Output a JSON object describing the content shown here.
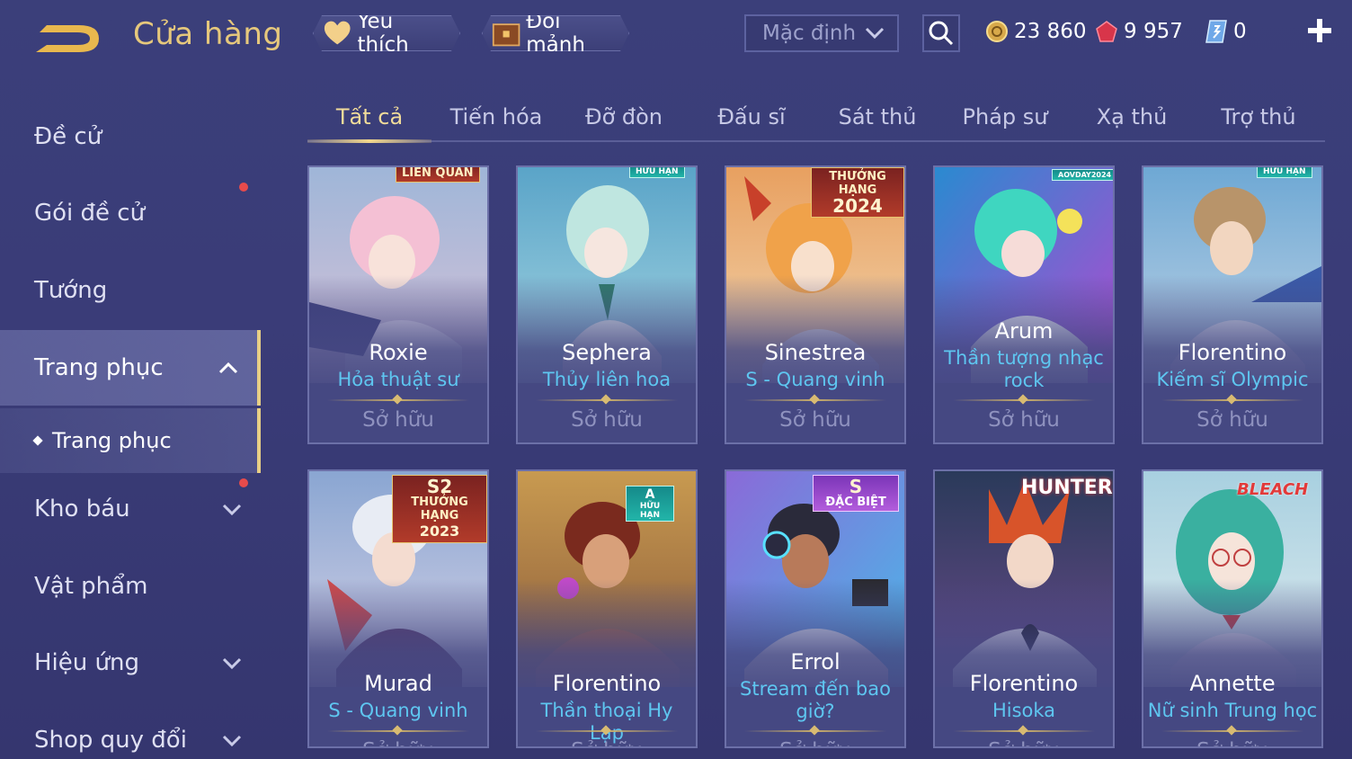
{
  "header": {
    "title": "Cửa hàng",
    "favorite_label": "Yêu thích",
    "shard_label": "Đổi mảnh",
    "sort_value": "Mặc định",
    "currency": {
      "gold": "23 860",
      "gems": "9 957",
      "vouchers": "0"
    }
  },
  "sidebar": {
    "items": [
      {
        "label": "Đề cử"
      },
      {
        "label": "Gói đề cử"
      },
      {
        "label": "Tướng"
      },
      {
        "label": "Trang phục"
      },
      {
        "label": "Kho báu"
      },
      {
        "label": "Vật phẩm"
      },
      {
        "label": "Hiệu ứng"
      },
      {
        "label": "Shop quy đổi"
      }
    ],
    "sub_item": "Trang phục"
  },
  "tabs": [
    "Tất cả",
    "Tiến hóa",
    "Đỡ đòn",
    "Đấu sĩ",
    "Sát thủ",
    "Pháp sư",
    "Xạ thủ",
    "Trợ thủ"
  ],
  "cards": [
    {
      "hero": "Roxie",
      "skin": "Hỏa thuật sư",
      "status": "Sở hữu",
      "badge": "LIÊN QUÂN"
    },
    {
      "hero": "Sephera",
      "skin": "Thủy liên hoa",
      "status": "Sở hữu",
      "badge": "HỮU HẠN"
    },
    {
      "hero": "Sinestrea",
      "skin": "S - Quang vinh",
      "status": "Sở hữu",
      "badge": "THƯỞNG HẠNG",
      "badge_year": "2024"
    },
    {
      "hero": "Arum",
      "skin": "Thần tượng nhạc rock",
      "status": "Sở hữu",
      "badge": "AOVDAY2024"
    },
    {
      "hero": "Florentino",
      "skin": "Kiếm sĩ Olympic",
      "status": "Sở hữu",
      "badge": "HỮU HẠN"
    },
    {
      "hero": "Murad",
      "skin": "S - Quang vinh",
      "status": "Sở hữu",
      "badge_top": "S2",
      "badge": "THƯỞNG HẠNG",
      "badge_year": "2023"
    },
    {
      "hero": "Florentino",
      "skin": "Thần thoại Hy Lạp",
      "status": "Sở hữu",
      "badge_top": "A",
      "badge": "HỮU HẠN"
    },
    {
      "hero": "Errol",
      "skin": "Stream đến bao giờ?",
      "status": "Sở hữu",
      "badge_top": "S",
      "badge": "ĐẶC BIỆT"
    },
    {
      "hero": "Florentino",
      "skin": "Hisoka",
      "status": "Sở hữu",
      "badge": "HUNTER"
    },
    {
      "hero": "Annette",
      "skin": "Nữ sinh Trung học",
      "status": "Sở hữu",
      "badge": "BLEACH"
    }
  ],
  "colors": {
    "accent_gold": "#e6c87c",
    "skin_name": "#5ec6f0",
    "background": "#3b3f7a"
  }
}
